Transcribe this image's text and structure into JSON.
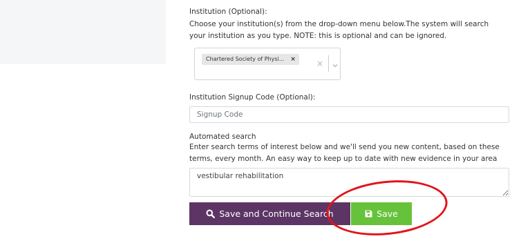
{
  "institution": {
    "label": "Institution (Optional):",
    "help_line1": "Choose your institution(s) from the drop-down menu below.The system will search",
    "help_line2": "your institution as you type. NOTE: this is optional and can be ignored.",
    "selected_tag": "Chartered Society of Physi...",
    "tag_remove_symbol": "×",
    "clear_symbol": "×",
    "dropdown_icon": "chevron-down-icon"
  },
  "signup_code": {
    "label": "Institution Signup Code (Optional):",
    "placeholder": "Signup Code",
    "value": ""
  },
  "automated_search": {
    "label": "Automated search",
    "help_line1": "Enter search terms of interest below and we'll send you new content, based on these",
    "help_line2": "terms, every month. An easy way to keep up to date with new evidence in your area",
    "value": "vestibular rehabilitation"
  },
  "buttons": {
    "save_continue": "Save and Continue Search",
    "save_continue_icon": "search-icon",
    "save": "Save",
    "save_icon": "floppy-disk-icon"
  },
  "colors": {
    "continue_button": "#5c3565",
    "save_button": "#66c23a",
    "annotation": "#e2131a"
  }
}
